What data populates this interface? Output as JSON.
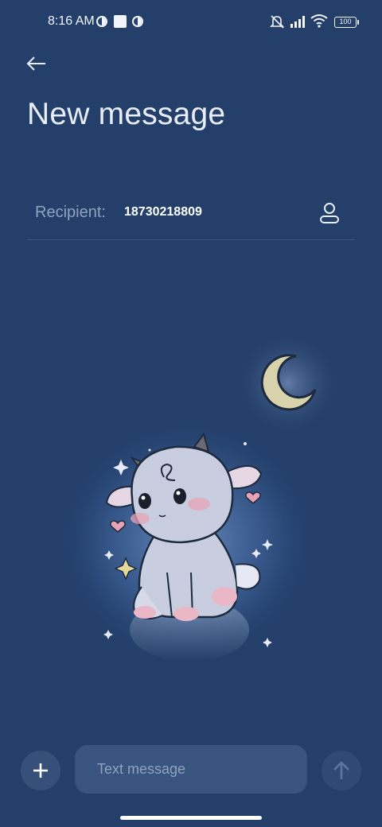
{
  "status_bar": {
    "time": "8:16 AM",
    "battery": "100",
    "icons": [
      "app-status-icon",
      "square-status-icon",
      "app-status-icon",
      "mute-icon",
      "signal-icon",
      "wifi-icon",
      "battery-icon"
    ]
  },
  "header": {
    "back_icon": "back-arrow-icon",
    "title": "New message"
  },
  "recipient": {
    "label": "Recipient:",
    "value": "18730218809",
    "contact_icon": "contact-icon"
  },
  "wallpaper": {
    "description_icon": "goat-illustration",
    "moon_icon": "moon-icon"
  },
  "composer": {
    "add_icon": "plus-icon",
    "placeholder": "Text message",
    "value": "",
    "send_icon": "send-arrow-icon"
  },
  "colors": {
    "background": "#233f6a",
    "input_bg": "#3a5480",
    "muted_text": "#8fa2c0"
  }
}
